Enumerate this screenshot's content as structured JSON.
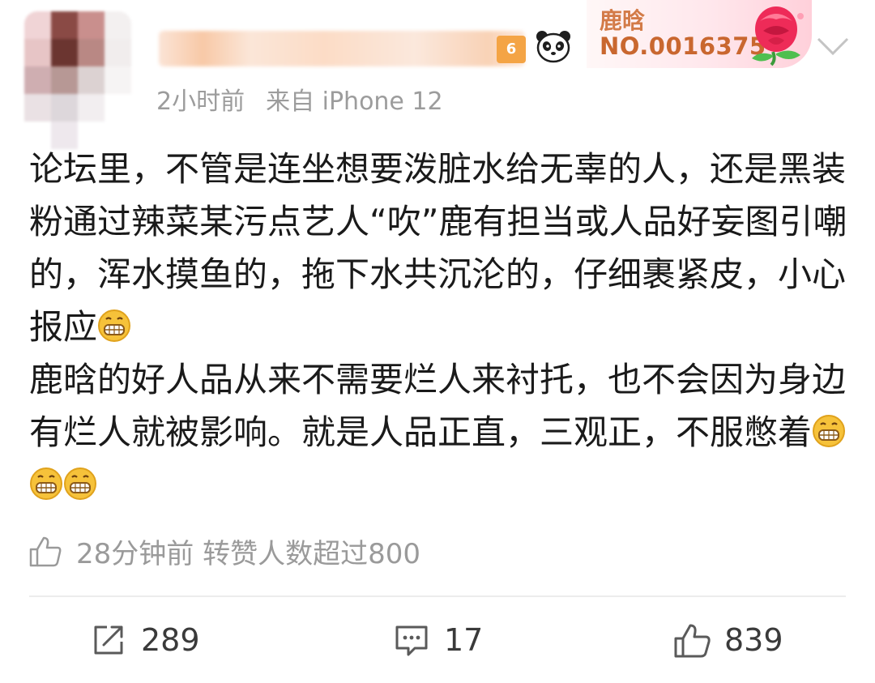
{
  "header": {
    "fan_badge": {
      "name": "鹿晗",
      "number": "NO.0016375"
    },
    "meta": {
      "time": "2小时前",
      "source": "来自 iPhone 12"
    }
  },
  "post": {
    "paragraphs": [
      {
        "text": "论坛里，不管是连坐想要泼脏水给无辜的人，还是黑装粉通过辣菜某污点艺人“吹”鹿有担当或人品好妄图引嘲的，浑水摸鱼的，拖下水共沉沦的，仔细裹紧皮，小心报应",
        "emojis": [
          "grin-emoji"
        ]
      },
      {
        "text": "鹿晗的好人品从来不需要烂人来衬托，也不会因为身边有烂人就被影响。就是人品正直，三观正，不服憋着",
        "emojis": [
          "grin-emoji",
          "grin-emoji",
          "grin-emoji"
        ]
      }
    ]
  },
  "notice": {
    "text": "28分钟前 转赞人数超过800",
    "icon": "like-icon"
  },
  "actions": {
    "repost": {
      "icon": "share-icon",
      "count": "289"
    },
    "comment": {
      "icon": "comment-icon",
      "count": "17"
    },
    "like": {
      "icon": "like-icon",
      "count": "839"
    }
  },
  "colors": {
    "meta_gray": "#9c9c9c",
    "fan_badge_text": "#c9672f",
    "emoji_yellow": "#f6c23a",
    "action_icon": "#5a5a5a"
  }
}
